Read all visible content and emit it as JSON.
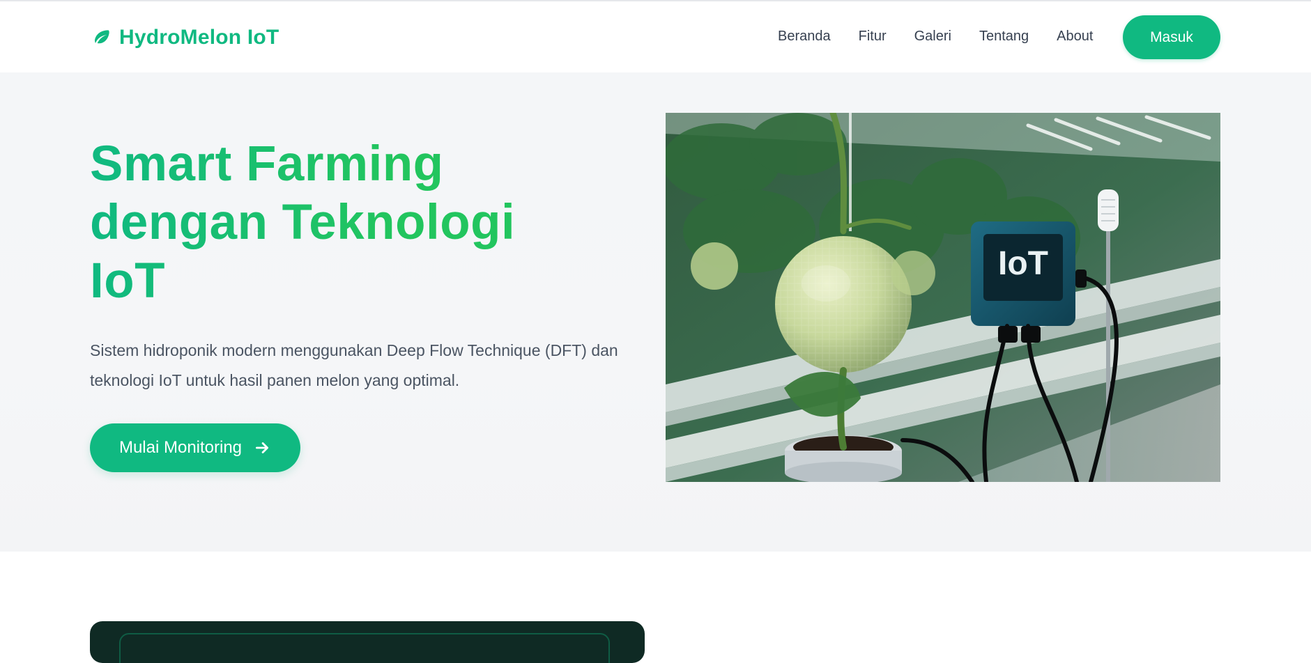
{
  "brand": {
    "name": "HydroMelon IoT",
    "icon": "leaf-icon",
    "color": "#10b981"
  },
  "nav": {
    "items": [
      {
        "label": "Beranda"
      },
      {
        "label": "Fitur"
      },
      {
        "label": "Galeri"
      },
      {
        "label": "Tentang"
      },
      {
        "label": "About"
      }
    ],
    "login_label": "Masuk"
  },
  "hero": {
    "title": "Smart Farming dengan Teknologi IoT",
    "description": "Sistem hidroponik modern menggunakan Deep Flow Technique (DFT) dan teknologi IoT untuk hasil panen melon yang optimal.",
    "cta_label": "Mulai Monitoring",
    "cta_icon": "arrow-right-icon",
    "image_text": "IoT"
  },
  "colors": {
    "accent": "#10b981",
    "accent_2": "#22c55e",
    "text": "#374151",
    "muted": "#4b5563",
    "hero_bg": "#f4f6f8",
    "dark_card": "#0f2a24"
  }
}
